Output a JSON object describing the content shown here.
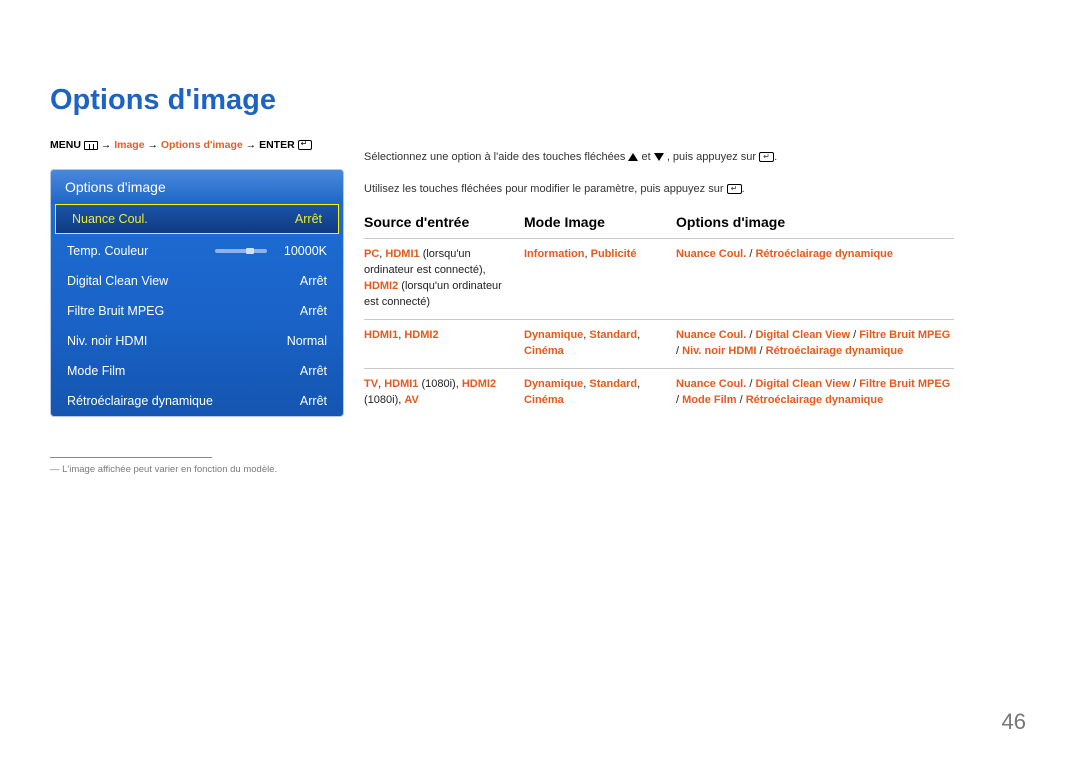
{
  "title": "Options d'image",
  "breadcrumb": {
    "menu": "MENU",
    "arrow": "→",
    "seg1": "Image",
    "seg2": "Options d'image",
    "enter": "ENTER"
  },
  "panel": {
    "header": "Options d'image",
    "rows": [
      {
        "label": "Nuance Coul.",
        "value": "Arrêt",
        "highlight": true
      },
      {
        "label": "Temp. Couleur",
        "value": "10000K",
        "slider": true
      },
      {
        "label": "Digital Clean View",
        "value": "Arrêt"
      },
      {
        "label": "Filtre Bruit MPEG",
        "value": "Arrêt"
      },
      {
        "label": "Niv. noir HDMI",
        "value": "Normal"
      },
      {
        "label": "Mode Film",
        "value": "Arrêt"
      },
      {
        "label": "Rétroéclairage dynamique",
        "value": "Arrêt"
      }
    ]
  },
  "footnote": "― L'image affichée peut varier en fonction du modèle.",
  "instructions": {
    "line1a": "Sélectionnez une option à l'aide des touches fléchées ",
    "line1b": " et ",
    "line1c": ", puis appuyez sur ",
    "line1d": ".",
    "line2a": "Utilisez les touches fléchées pour modifier le paramètre, puis appuyez sur ",
    "line2b": "."
  },
  "table": {
    "headers": [
      "Source d'entrée",
      "Mode Image",
      "Options d'image"
    ],
    "rows": [
      {
        "col1_parts": [
          {
            "t": "PC",
            "c": "red"
          },
          {
            "t": ", ",
            "c": "plain"
          },
          {
            "t": "HDMI1",
            "c": "red"
          },
          {
            "t": " (lorsqu'un ordinateur est connecté), ",
            "c": "plain"
          },
          {
            "t": "HDMI2",
            "c": "red"
          },
          {
            "t": " (lorsqu'un ordinateur est connecté)",
            "c": "plain"
          }
        ],
        "col2_parts": [
          {
            "t": "Information",
            "c": "red"
          },
          {
            "t": ", ",
            "c": "plain"
          },
          {
            "t": "Publicité",
            "c": "red"
          }
        ],
        "col3_parts": [
          {
            "t": "Nuance Coul.",
            "c": "red"
          },
          {
            "t": " / ",
            "c": "plain"
          },
          {
            "t": "Rétroéclairage dynamique",
            "c": "red"
          }
        ]
      },
      {
        "col1_parts": [
          {
            "t": "HDMI1",
            "c": "red"
          },
          {
            "t": ", ",
            "c": "plain"
          },
          {
            "t": "HDMI2",
            "c": "red"
          }
        ],
        "col2_parts": [
          {
            "t": "Dynamique",
            "c": "red"
          },
          {
            "t": ", ",
            "c": "plain"
          },
          {
            "t": "Standard",
            "c": "red"
          },
          {
            "t": ", ",
            "c": "plain"
          },
          {
            "t": "Cinéma",
            "c": "red"
          }
        ],
        "col3_parts": [
          {
            "t": "Nuance Coul.",
            "c": "red"
          },
          {
            "t": " / ",
            "c": "plain"
          },
          {
            "t": "Digital Clean View",
            "c": "red"
          },
          {
            "t": " / ",
            "c": "plain"
          },
          {
            "t": "Filtre Bruit MPEG",
            "c": "red"
          },
          {
            "t": " / ",
            "c": "plain"
          },
          {
            "t": "Niv. noir HDMI",
            "c": "red"
          },
          {
            "t": " / ",
            "c": "plain"
          },
          {
            "t": "Rétroéclairage dynamique",
            "c": "red"
          }
        ]
      },
      {
        "col1_parts": [
          {
            "t": "TV",
            "c": "red"
          },
          {
            "t": ", ",
            "c": "plain"
          },
          {
            "t": "HDMI1",
            "c": "red"
          },
          {
            "t": " (1080i), ",
            "c": "plain"
          },
          {
            "t": "HDMI2",
            "c": "red"
          },
          {
            "t": " (1080i), ",
            "c": "plain"
          },
          {
            "t": "AV",
            "c": "red"
          }
        ],
        "col2_parts": [
          {
            "t": "Dynamique",
            "c": "red"
          },
          {
            "t": ", ",
            "c": "plain"
          },
          {
            "t": "Standard",
            "c": "red"
          },
          {
            "t": ", ",
            "c": "plain"
          },
          {
            "t": "Cinéma",
            "c": "red"
          }
        ],
        "col3_parts": [
          {
            "t": "Nuance Coul.",
            "c": "red"
          },
          {
            "t": " / ",
            "c": "plain"
          },
          {
            "t": "Digital Clean View",
            "c": "red"
          },
          {
            "t": " / ",
            "c": "plain"
          },
          {
            "t": "Filtre Bruit MPEG",
            "c": "red"
          },
          {
            "t": " / ",
            "c": "plain"
          },
          {
            "t": "Mode Film",
            "c": "red"
          },
          {
            "t": " / ",
            "c": "plain"
          },
          {
            "t": "Rétroéclairage dynamique",
            "c": "red"
          }
        ]
      }
    ]
  },
  "page_number": "46"
}
